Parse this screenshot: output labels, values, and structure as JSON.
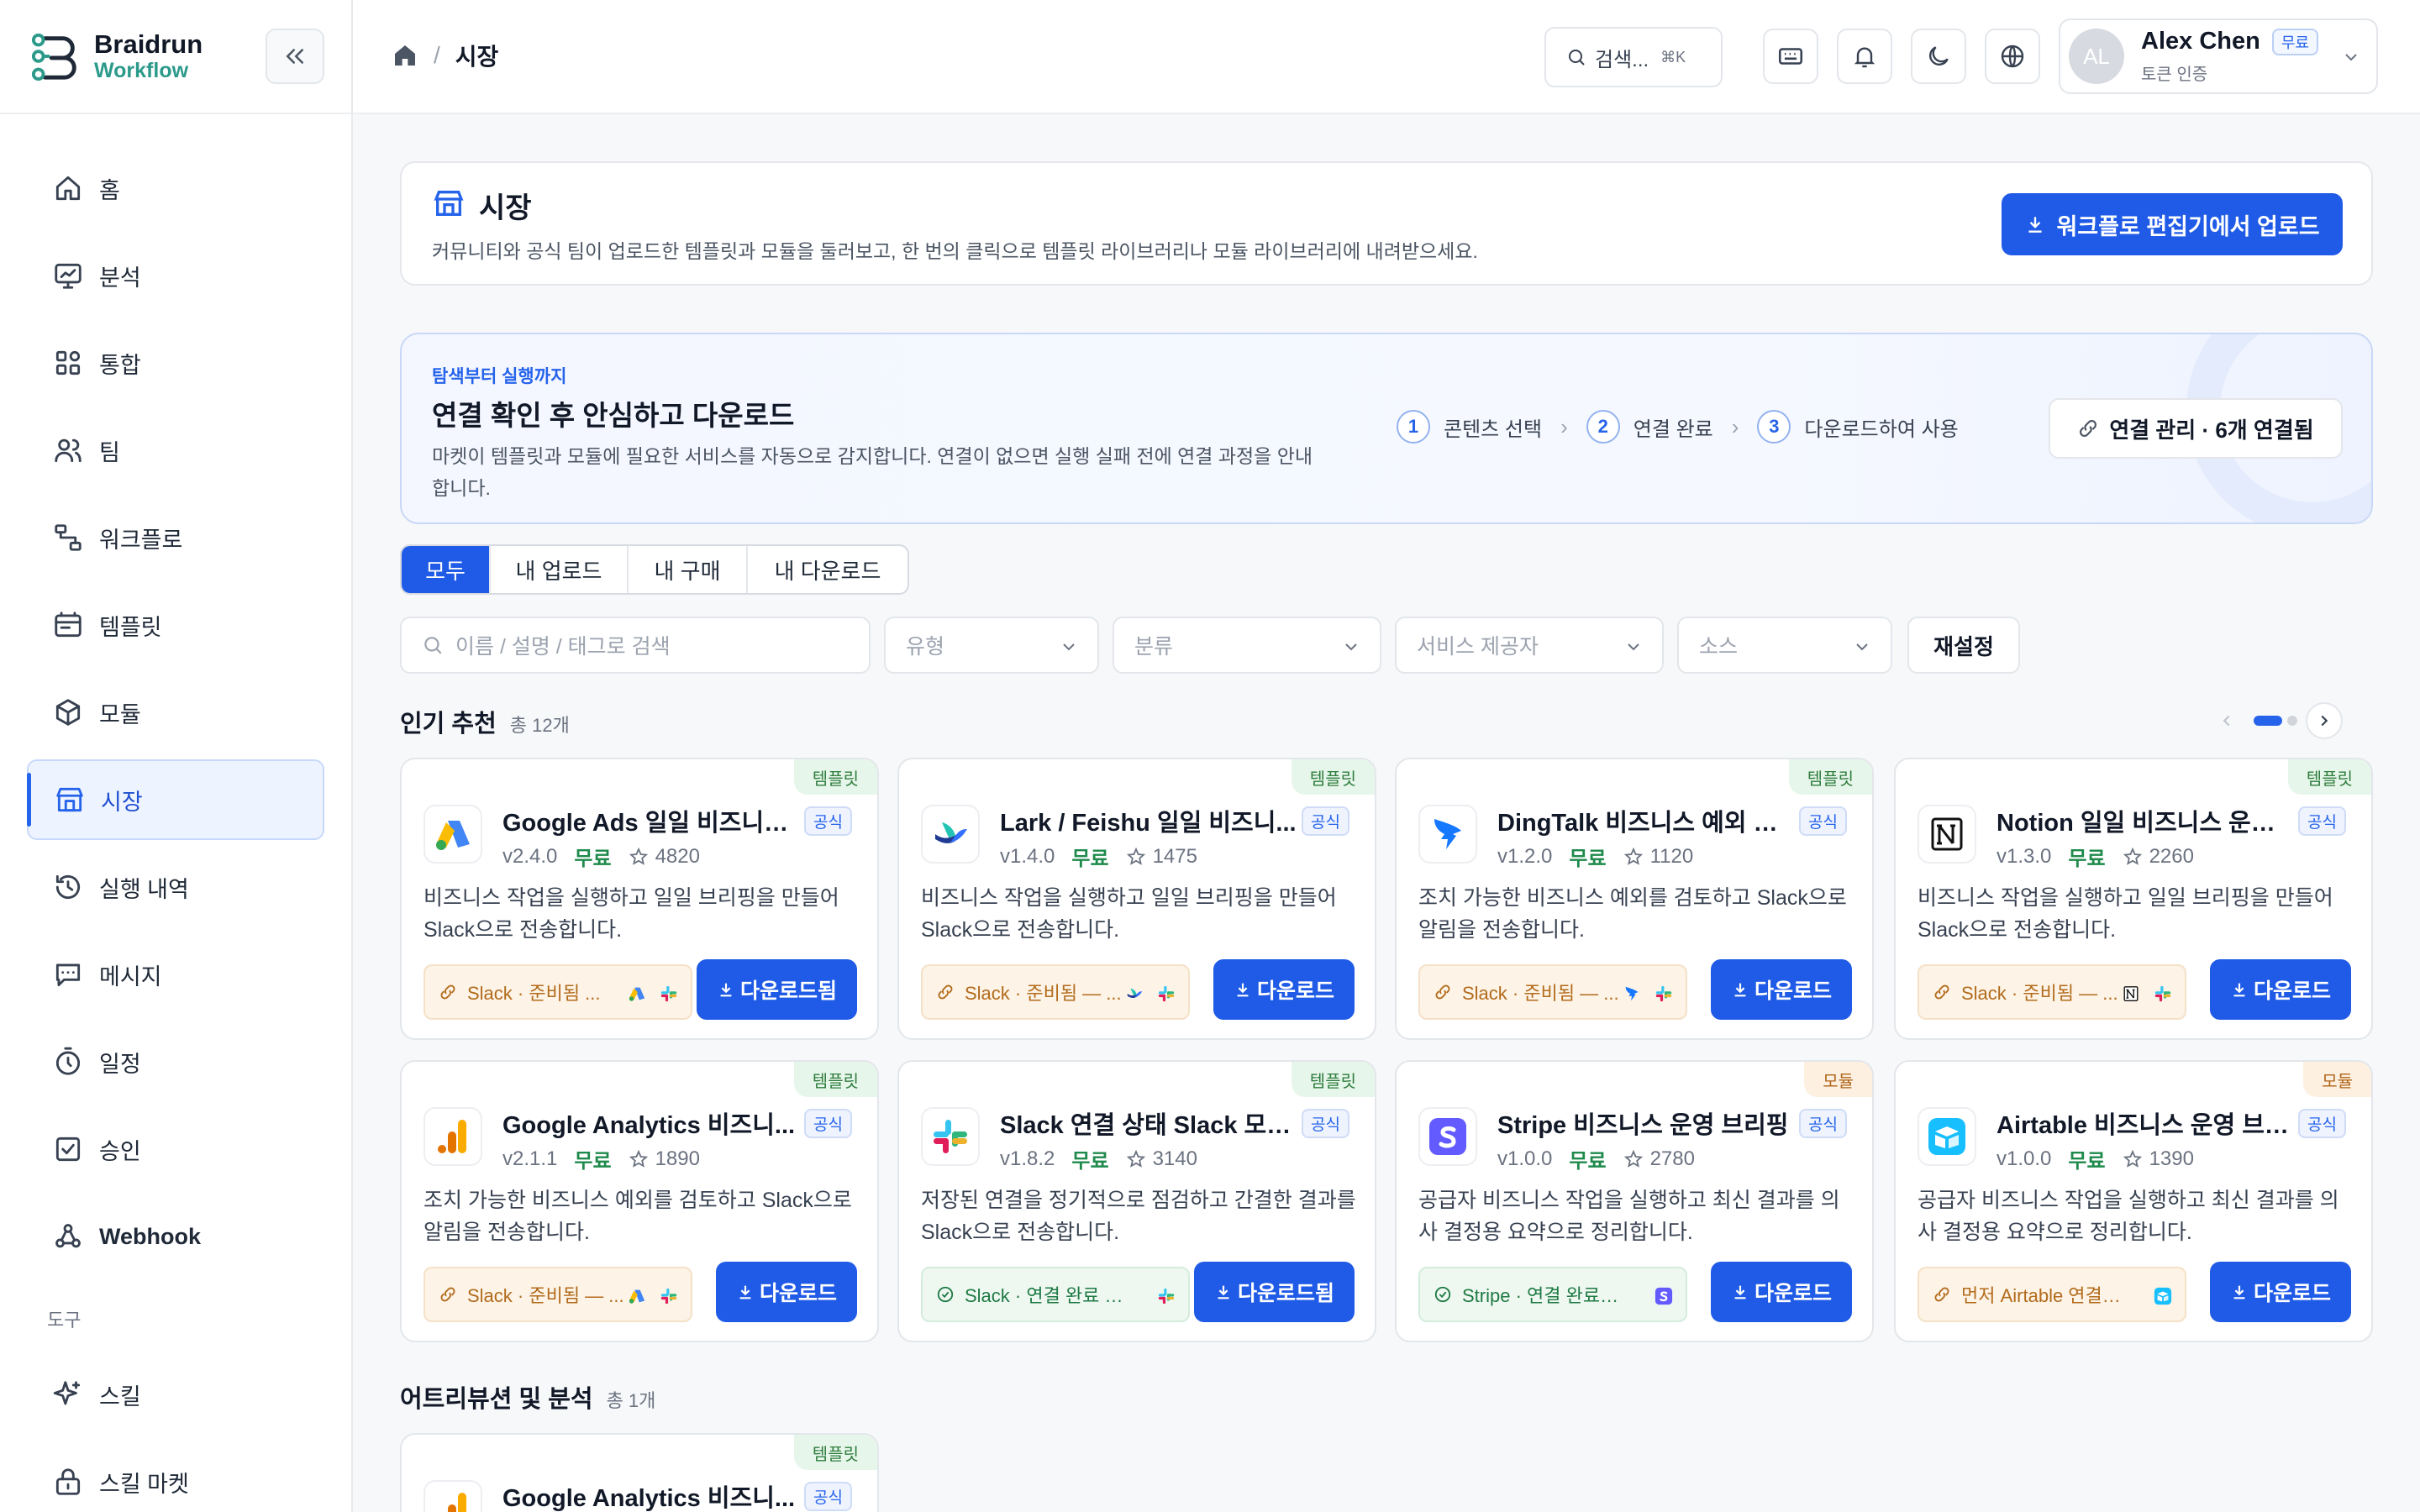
{
  "brand": {
    "name": "Braidrun",
    "sub": "Workflow"
  },
  "nav": {
    "items": [
      {
        "label": "홈",
        "icon": "home-icon"
      },
      {
        "label": "분석",
        "icon": "chart-monitor-icon"
      },
      {
        "label": "통합",
        "icon": "grid-icon"
      },
      {
        "label": "팀",
        "icon": "users-icon"
      },
      {
        "label": "워크플로",
        "icon": "workflow-icon"
      },
      {
        "label": "템플릿",
        "icon": "template-icon"
      },
      {
        "label": "모듈",
        "icon": "cube-icon"
      },
      {
        "label": "시장",
        "icon": "store-icon"
      },
      {
        "label": "실행 내역",
        "icon": "history-icon"
      },
      {
        "label": "메시지",
        "icon": "message-icon"
      },
      {
        "label": "일정",
        "icon": "timer-icon"
      },
      {
        "label": "승인",
        "icon": "check-square-icon"
      },
      {
        "label": "Webhook",
        "icon": "webhook-icon"
      }
    ],
    "tools_label": "도구",
    "tools": [
      {
        "label": "스킬",
        "icon": "sparkle-icon"
      },
      {
        "label": "스킬 마켓",
        "icon": "lock-bag-icon"
      }
    ]
  },
  "topbar": {
    "breadcrumb": "시장",
    "search_placeholder": "검색...",
    "search_kbd": "⌘K",
    "user": {
      "initials": "AL",
      "name": "Alex Chen",
      "plan": "무료",
      "status": "토큰 인증"
    }
  },
  "page": {
    "title": "시장",
    "description": "커뮤니티와 공식 팀이 업로드한 템플릿과 모듈을 둘러보고, 한 번의 클릭으로 템플릿 라이브러리나 모듈 라이브러리에 내려받으세요.",
    "upload_button": "워크플로 편집기에서 업로드"
  },
  "flow": {
    "kicker": "탐색부터 실행까지",
    "title": "연결 확인 후 안심하고 다운로드",
    "description": "마켓이 템플릿과 모듈에 필요한 서비스를 자동으로 감지합니다. 연결이 없으면 실행 실패 전에 연결 과정을 안내합니다.",
    "steps": [
      {
        "num": "1",
        "label": "콘텐츠 선택"
      },
      {
        "num": "2",
        "label": "연결 완료"
      },
      {
        "num": "3",
        "label": "다운로드하여 사용"
      }
    ],
    "manage_button": "연결 관리 · 6개 연결됨"
  },
  "tabs": [
    "모두",
    "내 업로드",
    "내 구매",
    "내 다운로드"
  ],
  "filters": {
    "search_placeholder": "이름 / 설명 / 태그로 검색",
    "type": "유형",
    "category": "분류",
    "provider": "서비스 제공자",
    "source": "소스",
    "reset": "재설정"
  },
  "sections": [
    {
      "title": "인기 추천",
      "count": "총 12개"
    },
    {
      "title": "어트리뷰션 및 분석",
      "count": "총 1개"
    }
  ],
  "cards": [
    {
      "tag": "템플릿",
      "tag_kind": "tpl",
      "logo": "google-ads",
      "title": "Google Ads 일일 비즈니스 ...",
      "official": "공식",
      "version": "v2.4.0",
      "price": "무료",
      "stars": "4820",
      "desc": "비즈니스 작업을 실행하고 일일 브리핑을 만들어 Slack으로 전송합니다.",
      "chip": "Slack · 준비됨 ...",
      "chip_kind": "warn",
      "minis": [
        "google-ads",
        "slack"
      ],
      "button": "다운로드됨"
    },
    {
      "tag": "템플릿",
      "tag_kind": "tpl",
      "logo": "lark",
      "title": "Lark / Feishu 일일 비즈니...",
      "official": "공식",
      "version": "v1.4.0",
      "price": "무료",
      "stars": "1475",
      "desc": "비즈니스 작업을 실행하고 일일 브리핑을 만들어 Slack으로 전송합니다.",
      "chip": "Slack · 준비됨 — ...",
      "chip_kind": "warn",
      "minis": [
        "lark",
        "slack"
      ],
      "button": "다운로드"
    },
    {
      "tag": "템플릿",
      "tag_kind": "tpl",
      "logo": "dingtalk",
      "title": "DingTalk 비즈니스 예외 알림",
      "official": "공식",
      "version": "v1.2.0",
      "price": "무료",
      "stars": "1120",
      "desc": "조치 가능한 비즈니스 예외를 검토하고 Slack으로 알림을 전송합니다.",
      "chip": "Slack · 준비됨 — ...",
      "chip_kind": "warn",
      "minis": [
        "dingtalk",
        "slack"
      ],
      "button": "다운로드"
    },
    {
      "tag": "템플릿",
      "tag_kind": "tpl",
      "logo": "notion",
      "title": "Notion 일일 비즈니스 운영 ...",
      "official": "공식",
      "version": "v1.3.0",
      "price": "무료",
      "stars": "2260",
      "desc": "비즈니스 작업을 실행하고 일일 브리핑을 만들어 Slack으로 전송합니다.",
      "chip": "Slack · 준비됨 — ...",
      "chip_kind": "warn",
      "minis": [
        "notion",
        "slack"
      ],
      "button": "다운로드"
    },
    {
      "tag": "템플릿",
      "tag_kind": "tpl",
      "logo": "google-analytics",
      "title": "Google Analytics 비즈니...",
      "official": "공식",
      "version": "v2.1.1",
      "price": "무료",
      "stars": "1890",
      "desc": "조치 가능한 비즈니스 예외를 검토하고 Slack으로 알림을 전송합니다.",
      "chip": "Slack · 준비됨 — ...",
      "chip_kind": "warn",
      "minis": [
        "google-ads",
        "slack"
      ],
      "button": "다운로드"
    },
    {
      "tag": "템플릿",
      "tag_kind": "tpl",
      "logo": "slack",
      "title": "Slack 연결 상태 Slack 모니터",
      "official": "공식",
      "version": "v1.8.2",
      "price": "무료",
      "stars": "3140",
      "desc": "저장된 연결을 정기적으로 점검하고 간결한 결과를 Slack으로 전송합니다.",
      "chip": "Slack · 연결 완료 —...",
      "chip_kind": "ok",
      "minis": [
        "slack"
      ],
      "button": "다운로드됨"
    },
    {
      "tag": "모듈",
      "tag_kind": "mod",
      "logo": "stripe",
      "title": "Stripe 비즈니스 운영 브리핑",
      "official": "공식",
      "version": "v1.0.0",
      "price": "무료",
      "stars": "2780",
      "desc": "공급자 비즈니스 작업을 실행하고 최신 결과를 의사 결정용 요약으로 정리합니다.",
      "chip": "Stripe · 연결 완료 — ...",
      "chip_kind": "ok",
      "minis": [
        "stripe"
      ],
      "button": "다운로드"
    },
    {
      "tag": "모듈",
      "tag_kind": "mod",
      "logo": "airtable",
      "title": "Airtable 비즈니스 운영 브리핑",
      "official": "공식",
      "version": "v1.0.0",
      "price": "무료",
      "stars": "1390",
      "desc": "공급자 비즈니스 작업을 실행하고 최신 결과를 의사 결정용 요약으로 정리합니다.",
      "chip": "먼저 Airtable 연결 필요",
      "chip_kind": "warn",
      "minis": [
        "airtable"
      ],
      "button": "다운로드"
    },
    {
      "tag": "템플릿",
      "tag_kind": "tpl",
      "logo": "google-analytics",
      "title": "Google Analytics 비즈니...",
      "official": "공식",
      "version": "",
      "price": "",
      "stars": "",
      "desc": "",
      "chip": "",
      "chip_kind": "warn",
      "minis": [],
      "button": ""
    }
  ]
}
